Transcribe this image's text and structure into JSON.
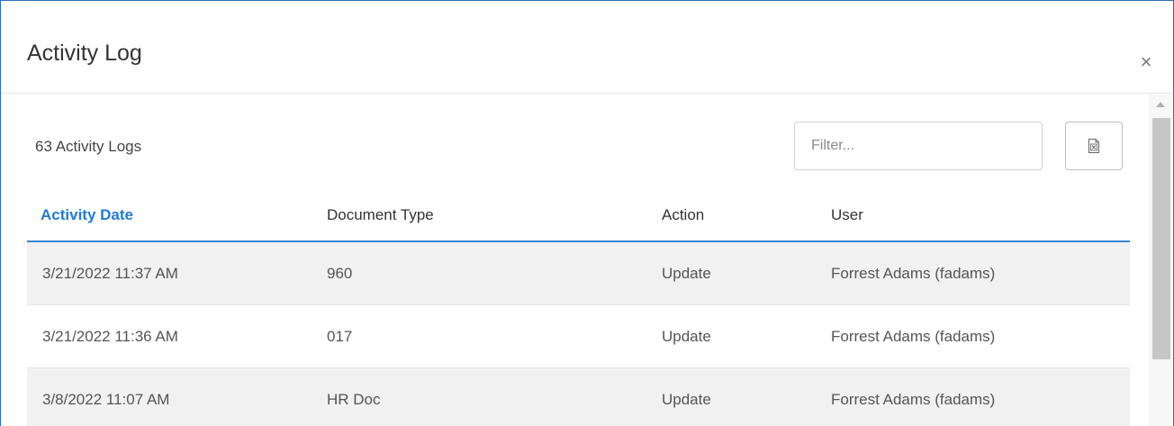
{
  "dialog": {
    "title": "Activity Log",
    "close_symbol": "×"
  },
  "toolbar": {
    "count_label": "63 Activity Logs",
    "filter_placeholder": "Filter...",
    "filter_value": "",
    "export_icon": "excel-export-icon"
  },
  "table": {
    "columns": [
      {
        "label": "Activity Date",
        "sorted": true
      },
      {
        "label": "Document Type",
        "sorted": false
      },
      {
        "label": "Action",
        "sorted": false
      },
      {
        "label": "User",
        "sorted": false
      }
    ],
    "rows": [
      {
        "date": "3/21/2022 11:37 AM",
        "doc_type": "960",
        "action": "Update",
        "user": "Forrest Adams (fadams)"
      },
      {
        "date": "3/21/2022 11:36 AM",
        "doc_type": "017",
        "action": "Update",
        "user": "Forrest Adams (fadams)"
      },
      {
        "date": "3/8/2022 11:07 AM",
        "doc_type": "HR Doc",
        "action": "Update",
        "user": "Forrest Adams (fadams)"
      }
    ]
  },
  "colors": {
    "accent": "#1f7ad8",
    "header_rule": "#3a86d6",
    "row_shade": "#f1f1f1",
    "dialog_border": "#2d6db5"
  }
}
